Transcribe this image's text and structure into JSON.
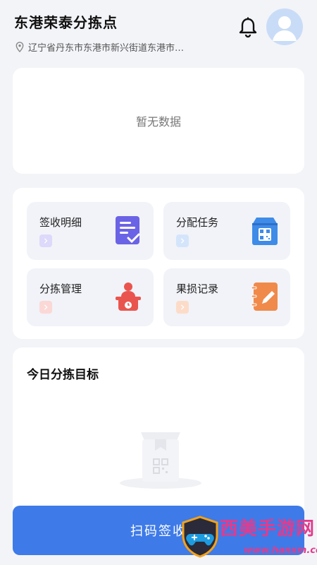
{
  "header": {
    "title": "东港荣泰分拣点",
    "address": "辽宁省丹东市东港市新兴街道东港市…"
  },
  "summary": {
    "empty_text": "暂无数据"
  },
  "functions": [
    {
      "label": "签收明细",
      "icon": "checklist-icon",
      "color": "#6b63e6"
    },
    {
      "label": "分配任务",
      "icon": "qr-box-icon",
      "color": "#3f8be8"
    },
    {
      "label": "分拣管理",
      "icon": "sorting-person-icon",
      "color": "#e9554e"
    },
    {
      "label": "果损记录",
      "icon": "notebook-pen-icon",
      "color": "#f08a4b"
    }
  ],
  "target": {
    "title": "今日分拣目标"
  },
  "bottom_button": {
    "label": "扫码签收"
  },
  "watermark": {
    "title": "西美手游网",
    "url": "www.hanxm.com"
  }
}
